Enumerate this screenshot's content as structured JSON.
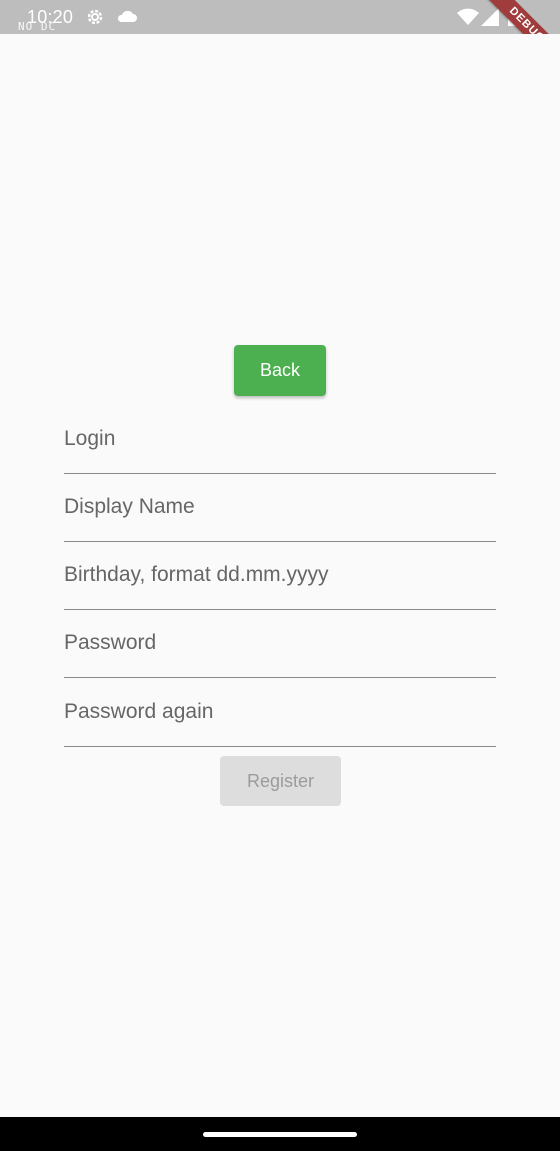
{
  "status_bar": {
    "time": "10:20",
    "overlay_text": "NO DC",
    "left_icons": [
      "settings-gear-icon",
      "cloud-icon"
    ],
    "right_icons": [
      "wifi-icon",
      "cellular-signal-icon",
      "battery-icon"
    ]
  },
  "debug_banner": {
    "label": "DEBUG"
  },
  "form": {
    "back_label": "Back",
    "fields": [
      {
        "placeholder": "Login",
        "value": ""
      },
      {
        "placeholder": "Display Name",
        "value": ""
      },
      {
        "placeholder": "Birthday, format dd.mm.yyyy",
        "value": ""
      },
      {
        "placeholder": "Password",
        "value": ""
      },
      {
        "placeholder": "Password again",
        "value": ""
      }
    ],
    "register_label": "Register",
    "register_enabled": false
  },
  "colors": {
    "accent": "#4caf50",
    "status_bar": "#bdbdbd",
    "background": "#fafafa",
    "disabled_button": "#dddddd",
    "debug_banner": "#a03c3c"
  }
}
